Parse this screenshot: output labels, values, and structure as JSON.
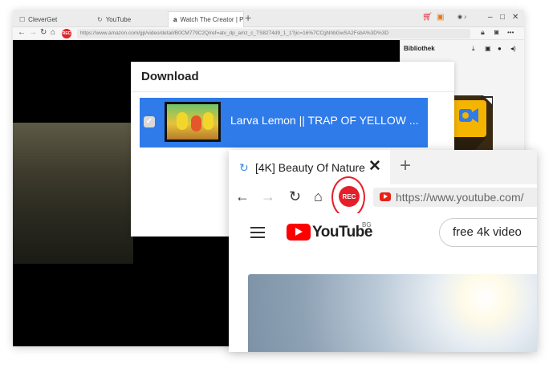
{
  "back_window": {
    "tabs": [
      {
        "label": "CleverGet",
        "icon": "cleverget-icon"
      },
      {
        "label": "YouTube",
        "icon": "youtube-loading-icon"
      },
      {
        "label": "Watch The Creator | Pr",
        "icon": "amazon-icon",
        "active": true
      }
    ],
    "new_tab": "+",
    "url": "https://www.amazon.com/gp/video/detail/B0CM779C2Q/ref=atv_dp_amz_c_TS8274d9_1_1?jic=16%7CCgNhbGwSA2FsbA%3D%3D",
    "rec_label": "REC",
    "library_title": "Bibliothek",
    "window_controls": [
      "–",
      "□",
      "✕"
    ],
    "more": "•••"
  },
  "download_dialog": {
    "title": "Download",
    "item_title": "Larva Lemon || TRAP OF YELLOW ...",
    "checked": true
  },
  "front_window": {
    "tab_title": "[4K] Beauty Of Nature",
    "close": "✕",
    "new_tab": "+",
    "rec_label": "REC",
    "url": "https://www.youtube.com/",
    "youtube_wordmark": "YouTube",
    "country_code": "BG",
    "search_value": "free 4k video"
  },
  "colors": {
    "accent_blue": "#2f7bea",
    "rec_red": "#e3202a",
    "youtube_red": "#ff0000"
  }
}
